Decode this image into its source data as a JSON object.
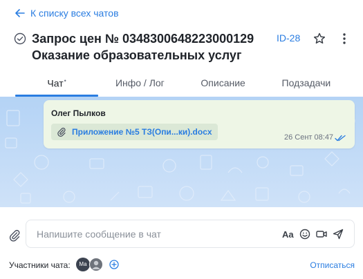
{
  "header": {
    "back_label": "К списку всех чатов",
    "title_line1": "Запрос цен № 0348300648223000129",
    "title_line2": "Оказание образовательных услуг",
    "ticket_id": "ID-28",
    "status_icon": "check-circle-icon",
    "star_icon": "star-icon",
    "more_icon": "more-vertical-icon"
  },
  "tabs": [
    {
      "label": "Чат",
      "badge": "•",
      "active": true
    },
    {
      "label": "Инфо / Лог",
      "active": false
    },
    {
      "label": "Описание",
      "active": false
    },
    {
      "label": "Подзадачи",
      "active": false
    }
  ],
  "messages": [
    {
      "author": "Олег Пылков",
      "attachment": "Приложение №5 ТЗ(Опи...ки).docx",
      "time": "26 Сент 08:47",
      "status": "read"
    }
  ],
  "composer": {
    "placeholder": "Напишите сообщение в чат",
    "format_label": "Aa",
    "icons": [
      "paperclip-icon",
      "text-format-icon",
      "emoji-icon",
      "video-icon",
      "send-icon"
    ]
  },
  "participants": {
    "label": "Участники чата:",
    "avatars": [
      "Ма",
      "avatar-photo"
    ],
    "unsubscribe_label": "Отписаться"
  },
  "colors": {
    "accent": "#2a7de1",
    "chat_background": "#c4dcf7",
    "bubble": "#eef6e6"
  }
}
